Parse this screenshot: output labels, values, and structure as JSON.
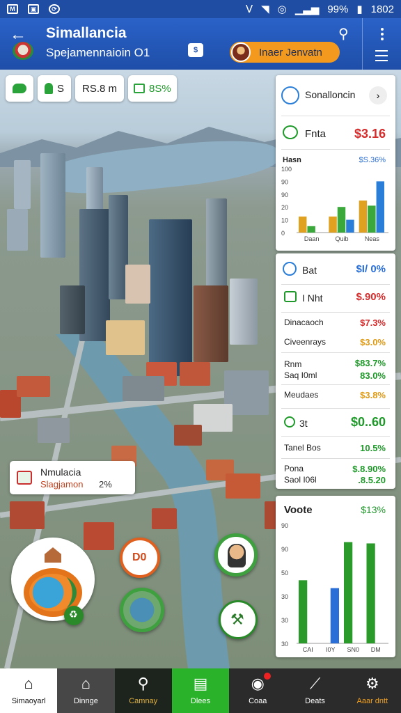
{
  "status_bar": {
    "battery": "99%",
    "time": "1802"
  },
  "header": {
    "title": "Simallancia",
    "subtitle": "Spejamennaioin O1",
    "action_button": "Inaer Jenvatn",
    "accent": "#2a62c8",
    "button_color": "#f39a1e"
  },
  "chips": [
    {
      "icon": "leaf-icon",
      "value": ""
    },
    {
      "icon": "person-icon",
      "value": "S"
    },
    {
      "icon": "none",
      "value": "RS.8 m"
    },
    {
      "icon": "money-icon",
      "value": "8S%"
    }
  ],
  "panel_a": {
    "search_label": "Sonalloncin",
    "row_label": "Fnta",
    "row_value": "$3.16",
    "chart": {
      "header": "Hasn",
      "header_value": "$S.36%",
      "ytick_labels": [
        "100",
        "90",
        "90",
        "20",
        "10",
        "0"
      ],
      "xtick_labels": [
        "Daan",
        "Quib",
        "Neas"
      ]
    }
  },
  "panel_b": {
    "rows": [
      {
        "icon": "bank-icon",
        "label": "Bat",
        "value": "$I/ 0%",
        "color": "blue"
      },
      {
        "icon": "money-icon",
        "label": "I Nht",
        "value": "$.90%",
        "color": "red"
      },
      {
        "icon": "",
        "label": "Dinacaoch",
        "value": "$7.3%",
        "color": "red"
      },
      {
        "icon": "",
        "label": "Civeenrays",
        "value": "$3.0%",
        "color": "orange"
      },
      {
        "icon": "",
        "label": "Rnm",
        "value": "$83.7%",
        "color": "green"
      },
      {
        "icon": "",
        "label": "Saq I0ml",
        "value": "83.0%",
        "color": "green"
      },
      {
        "icon": "",
        "label": "Meudaes",
        "value": "$3.8%",
        "color": "orange"
      }
    ],
    "rows2": [
      {
        "icon": "coin-icon",
        "label": "3t",
        "value": "$0..60",
        "color": "green"
      },
      {
        "icon": "",
        "label": "Tanel Bos",
        "value": "10.5%",
        "color": "green"
      },
      {
        "icon": "",
        "label": "Pona",
        "value": "$.8.90%",
        "color": "green"
      },
      {
        "icon": "",
        "label": "Saol I06l",
        "value": ".8.5.20",
        "color": "green"
      }
    ]
  },
  "panel_c": {
    "title": "Voote",
    "value": "$13%",
    "ytick_labels": [
      "90",
      "90",
      "50",
      "30",
      "30",
      "30"
    ],
    "xtick_labels": [
      "CAI",
      "I0Y",
      "SN0",
      "DM"
    ]
  },
  "info_card": {
    "title": "Nmulacia",
    "subtitle": "Slagjamon",
    "value": "2%"
  },
  "bubbles": {
    "badge_text": "D0"
  },
  "chart_data": [
    {
      "type": "bar",
      "categories": [
        "Daan",
        "Quib",
        "Neas"
      ],
      "series": [
        {
          "values": [
            25,
            25,
            50
          ],
          "color": "#e0a020"
        },
        {
          "values": [
            10,
            40,
            42
          ],
          "color": "#3aa83a"
        },
        {
          "values": [
            0,
            20,
            80
          ],
          "color": "#2a7ed8"
        }
      ],
      "ylim": [
        0,
        100
      ]
    },
    {
      "type": "bar",
      "categories": [
        "CAI",
        "I0Y",
        "SN0",
        "DM"
      ],
      "series": [
        {
          "values": [
            48,
            0,
            77,
            76
          ],
          "color": "#2a9a2a"
        },
        {
          "values": [
            0,
            42,
            0,
            0
          ],
          "color": "#2a6ed8"
        }
      ],
      "ylim": [
        0,
        90
      ]
    }
  ],
  "bottom_nav": [
    {
      "icon": "home-icon",
      "label": "Simaoyarl"
    },
    {
      "icon": "house-icon",
      "label": "Dinnge"
    },
    {
      "icon": "search-icon",
      "label": "Camnay"
    },
    {
      "icon": "document-icon",
      "label": "Dlees"
    },
    {
      "icon": "gauge-icon",
      "label": "Coaa"
    },
    {
      "icon": "chart-icon",
      "label": "Deats"
    },
    {
      "icon": "gear-icon",
      "label": "Aaar dntt"
    }
  ]
}
